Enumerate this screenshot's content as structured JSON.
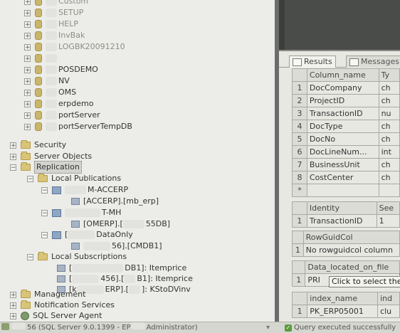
{
  "explorer": {
    "databases": [
      {
        "label": "Custom",
        "faded": true
      },
      {
        "label": "SETUP",
        "faded": true
      },
      {
        "label": "HELP",
        "faded": true
      },
      {
        "label": "InvBak",
        "faded": true
      },
      {
        "label": "LOGBK20091210",
        "faded": true
      },
      {
        "label": "",
        "faded": true
      },
      {
        "label": "POSDEMO",
        "faded": false
      },
      {
        "label": "NV",
        "faded": false
      },
      {
        "label": "OMS",
        "faded": false
      },
      {
        "label": "erpdemo",
        "faded": false
      },
      {
        "label": "portServer",
        "faded": false
      },
      {
        "label": "portServerTempDB",
        "faded": false
      }
    ],
    "security": "Security",
    "server_objects": "Server Objects",
    "replication": "Replication",
    "local_publications": "Local Publications",
    "pub1": "M-ACCERP",
    "pub1_child": "[ACCERP].[mb_erp]",
    "pub2": "T-MH",
    "pub2_child": "[OMERP].[",
    "pub2_child_suffix": "55DB]",
    "pub3": "[",
    "pub3_suffix": "DataOnly",
    "pub3_child": "56].[CMDB1]",
    "local_subscriptions": "Local Subscriptions",
    "sub1_prefix": "[",
    "sub1": "DB1]: Itemprice",
    "sub2_prefix": "[",
    "sub2": "456].[",
    "sub2_suffix": "B1]: Itemprice",
    "sub3_prefix": "[k",
    "sub3": "ERP].[",
    "sub3_suffix": "]: KStoDVinv",
    "management": "Management",
    "notification_services": "Notification Services",
    "sql_server_agent": "SQL Server Agent"
  },
  "statusbar": {
    "server": "56 (SQL Server 9.0.1399 - EP",
    "server_suffix": "Administrator)",
    "query_status": "Query executed successfully"
  },
  "results": {
    "tab_results": "Results",
    "tab_messages": "Messages",
    "grid1_headers": [
      "Column_name",
      "Ty"
    ],
    "grid1_rows": [
      {
        "n": "1",
        "name": "DocCompany",
        "type": "ch"
      },
      {
        "n": "2",
        "name": "ProjectID",
        "type": "ch"
      },
      {
        "n": "3",
        "name": "TransactionID",
        "type": "nu"
      },
      {
        "n": "4",
        "name": "DocType",
        "type": "ch"
      },
      {
        "n": "5",
        "name": "DocNo",
        "type": "ch"
      },
      {
        "n": "6",
        "name": "DocLineNum...",
        "type": "int"
      },
      {
        "n": "7",
        "name": "BusinessUnit",
        "type": "ch"
      },
      {
        "n": "8",
        "name": "CostCenter",
        "type": "ch"
      }
    ],
    "grid1_more": "*",
    "grid2_headers": [
      "Identity",
      "See"
    ],
    "grid2_row": {
      "n": "1",
      "name": "TransactionID",
      "value": "1"
    },
    "grid3_header": "RowGuidCol",
    "grid3_row": {
      "n": "1",
      "value": "No rowguidcol column"
    },
    "grid4_header": "Data_located_on_file",
    "grid4_row": {
      "n": "1",
      "value": "PRI"
    },
    "tooltip": "Click to select the",
    "grid5_headers": [
      "index_name",
      "ind"
    ],
    "grid5_row": {
      "n": "1",
      "name": "PK_ERP05001",
      "value": "clu"
    }
  }
}
